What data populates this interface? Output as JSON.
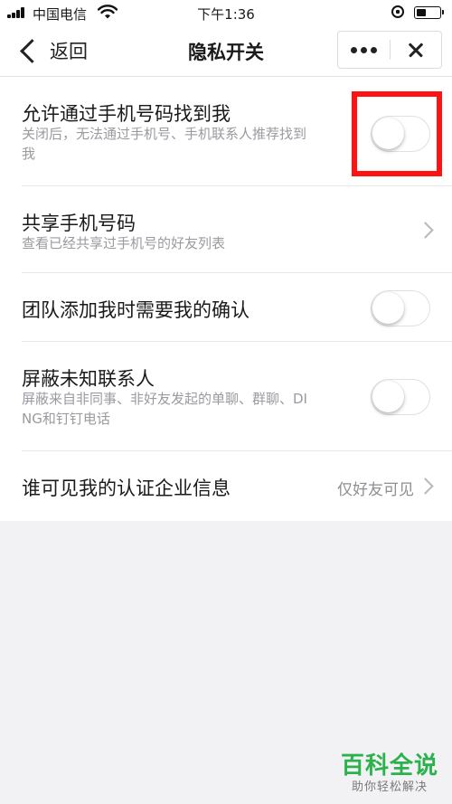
{
  "status_bar": {
    "carrier": "中国电信",
    "time": "下午1:36",
    "battery_level": 0.45,
    "icons": [
      "signal-icon",
      "wifi-icon",
      "rotation-lock-icon",
      "battery-icon"
    ]
  },
  "nav": {
    "back_label": "返回",
    "title": "隐私开关",
    "more_icon": "more-dots-icon",
    "close_icon": "close-icon"
  },
  "settings": [
    {
      "title": "允许通过手机号码找到我",
      "description_lines": [
        "关闭后，无法通过手机号、手机联系人推荐找到",
        "我"
      ],
      "control": "toggle",
      "on": false
    },
    {
      "title": "共享手机号码",
      "description_lines": [
        "查看已经共享过手机号的好友列表"
      ],
      "control": "chevron"
    },
    {
      "title": "团队添加我时需要我的确认",
      "description_lines": [],
      "control": "toggle",
      "on": false
    },
    {
      "title": "屏蔽未知联系人",
      "description_lines": [
        "屏蔽来自非同事、非好友发起的单聊、群聊、DI",
        "NG和钉钉电话"
      ],
      "control": "toggle",
      "on": false
    },
    {
      "title": "谁可见我的认证企业信息",
      "description_lines": [],
      "control": "value-chevron",
      "value": "仅好友可见"
    }
  ],
  "colors": {
    "highlight": "#ff1212",
    "watermark_green": "#2bb24c"
  },
  "watermark": {
    "title": "百科全说",
    "subtitle": "助你轻松解决"
  }
}
